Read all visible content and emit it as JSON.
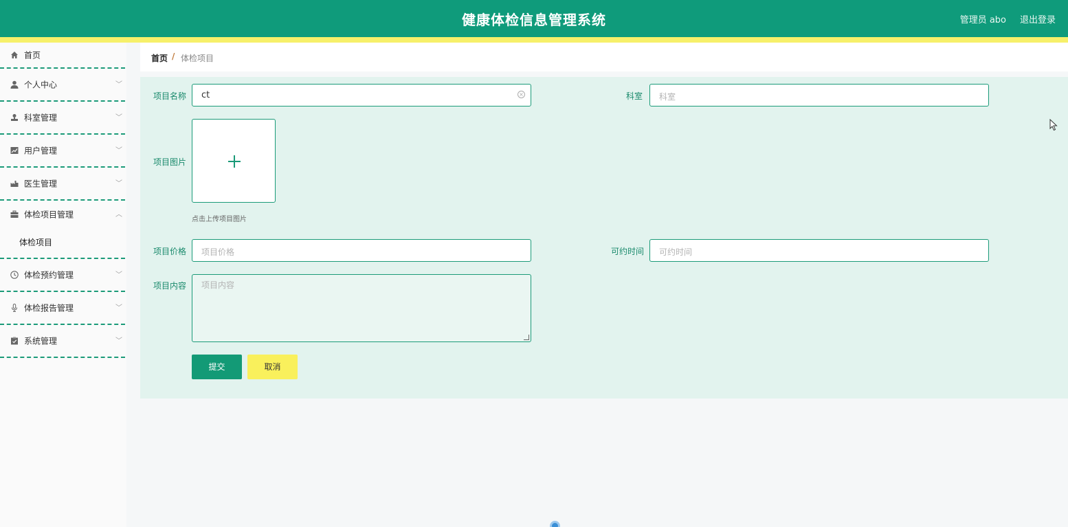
{
  "header": {
    "title": "健康体检信息管理系统",
    "user": "管理员 abo",
    "logout": "退出登录"
  },
  "sidebar": {
    "items": [
      {
        "label": "首页",
        "icon": "home-icon"
      },
      {
        "label": "个人中心",
        "icon": "user-icon"
      },
      {
        "label": "科室管理",
        "icon": "user-icon"
      },
      {
        "label": "用户管理",
        "icon": "chart-icon"
      },
      {
        "label": "医生管理",
        "icon": "factory-icon"
      },
      {
        "label": "体检项目管理",
        "icon": "briefcase-icon"
      },
      {
        "label": "体检预约管理",
        "icon": "clock-icon"
      },
      {
        "label": "体检报告管理",
        "icon": "microphone-icon"
      },
      {
        "label": "系统管理",
        "icon": "clipboard-icon"
      }
    ],
    "submenu": {
      "label": "体检项目"
    }
  },
  "breadcrumb": {
    "home": "首页",
    "separator": "/",
    "current": "体检项目"
  },
  "form": {
    "name_label": "项目名称",
    "name_value": "ct",
    "dept_label": "科室",
    "dept_placeholder": "科室",
    "image_label": "项目图片",
    "upload_tip": "点击上传项目图片",
    "price_label": "项目价格",
    "price_placeholder": "项目价格",
    "time_label": "可约时间",
    "time_placeholder": "可约时间",
    "content_label": "项目内容",
    "content_placeholder": "项目内容",
    "submit": "提交",
    "cancel": "取消"
  },
  "colors": {
    "primary": "#0f9b7b",
    "accent": "#f6f06a",
    "panel": "#e2f3ee"
  }
}
